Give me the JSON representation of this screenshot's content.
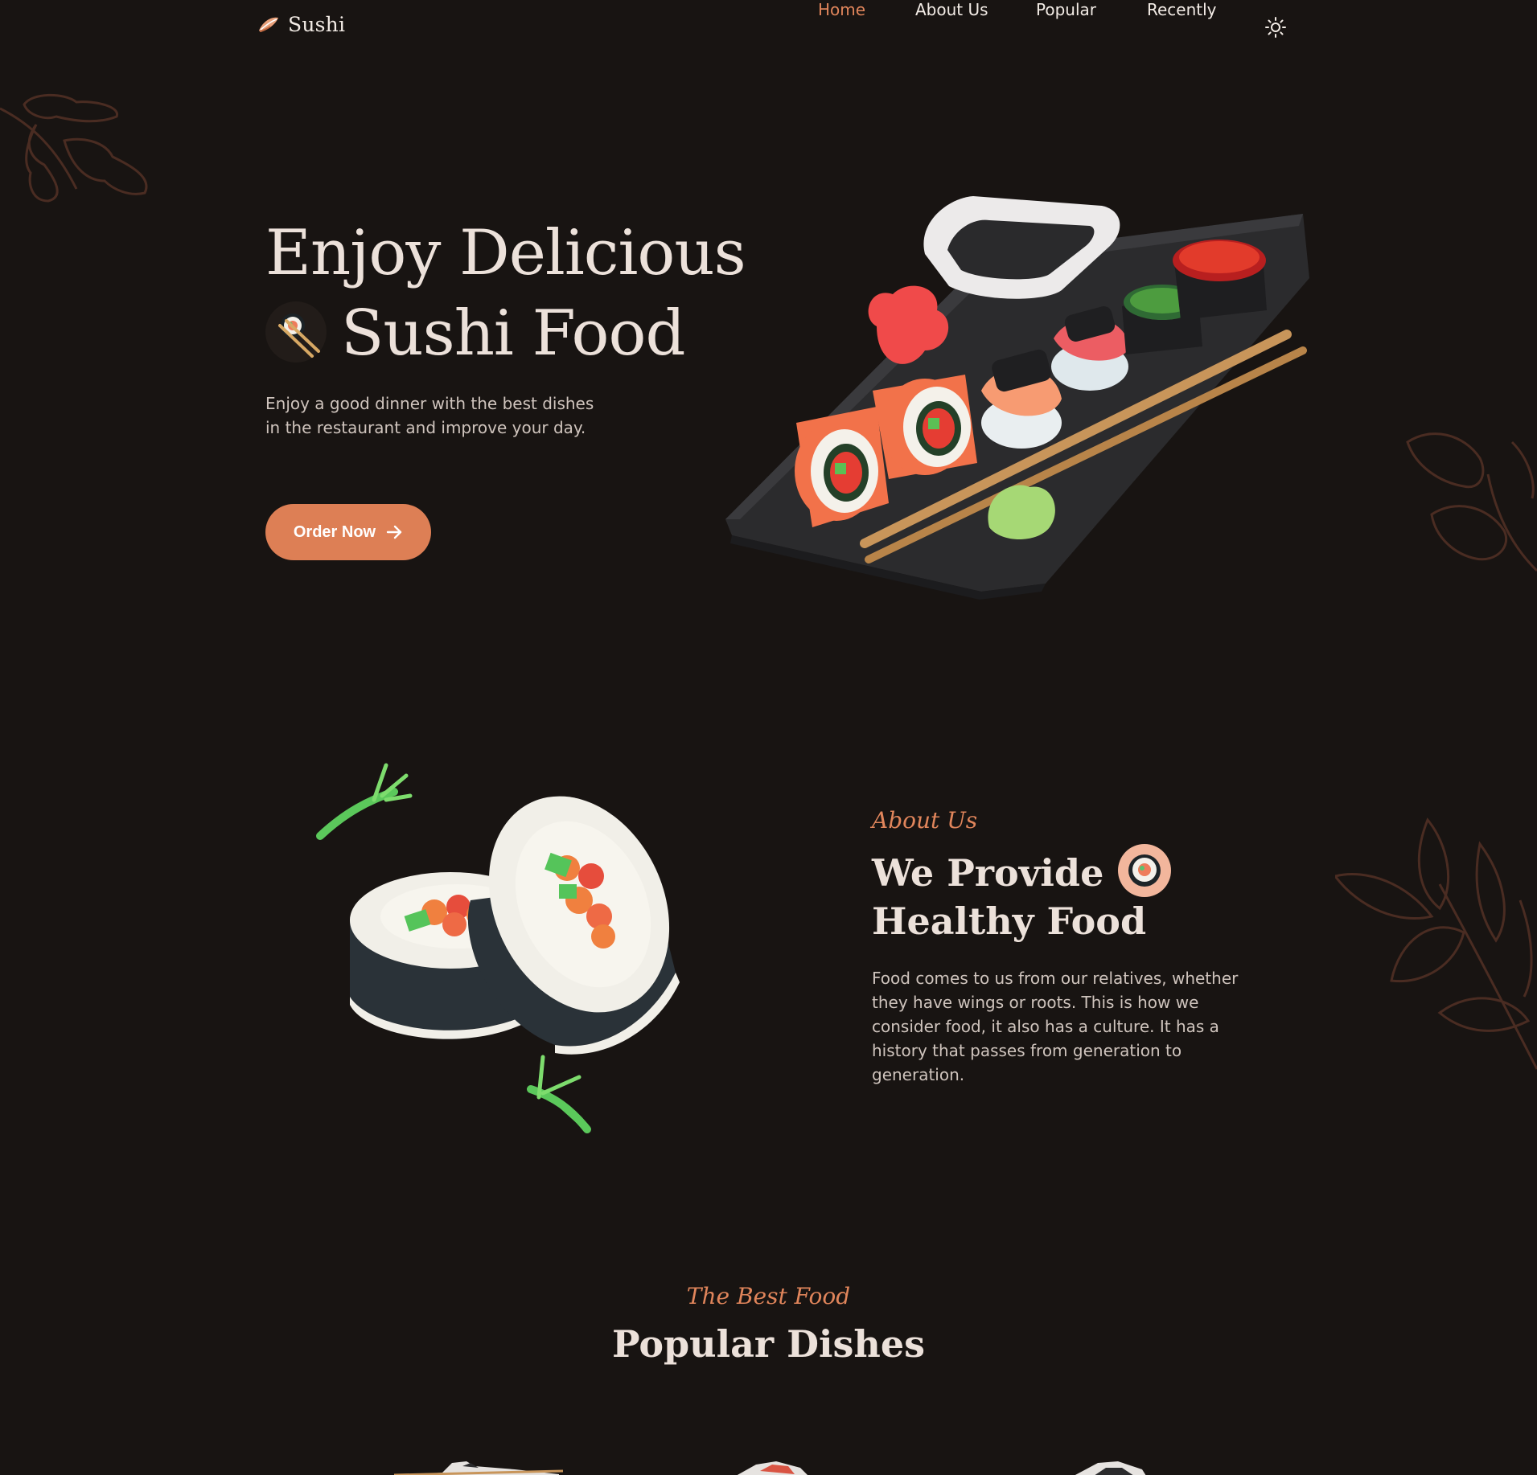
{
  "brand": {
    "name": "Sushi"
  },
  "nav": {
    "items": [
      {
        "label": "Home",
        "active": true
      },
      {
        "label": "About Us",
        "active": false
      },
      {
        "label": "Popular",
        "active": false
      },
      {
        "label": "Recently",
        "active": false
      }
    ],
    "theme_toggle_icon": "sun-icon"
  },
  "hero": {
    "title_line1": "Enjoy Delicious",
    "title_line2": "Sushi Food",
    "description": "Enjoy a good dinner with the best dishes in the restaurant and improve your day.",
    "cta_label": "Order Now",
    "cta_icon": "arrow-right-icon"
  },
  "about": {
    "subtitle": "About Us",
    "title_line1": "We Provide",
    "title_line2": "Healthy Food",
    "description": "Food comes to us from our relatives, whether they have wings or roots. This is how we consider food, it also has a culture. It has a history that passes from generation to generation."
  },
  "popular": {
    "subtitle": "The Best Food",
    "title": "Popular Dishes"
  },
  "colors": {
    "background": "#181412",
    "accent": "#e0855b",
    "text": "#ece1da",
    "muted": "#cfc4bd",
    "leaf": "#4a2c22"
  }
}
